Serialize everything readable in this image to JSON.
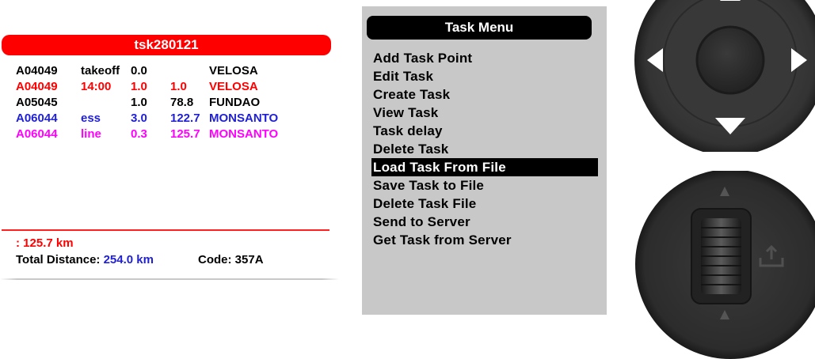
{
  "task": {
    "name": "tsk280121",
    "rows": [
      {
        "code": "A04049",
        "type": "takeoff",
        "radius": "0.0",
        "dist": "",
        "name": "VELOSA",
        "color": "#000000"
      },
      {
        "code": "A04049",
        "type": "14:00",
        "radius": "1.0",
        "dist": "1.0",
        "name": "VELOSA",
        "color": "#ff0000"
      },
      {
        "code": "A05045",
        "type": "",
        "radius": "1.0",
        "dist": "78.8",
        "name": "FUNDAO",
        "color": "#000000"
      },
      {
        "code": "A06044",
        "type": "ess",
        "radius": "3.0",
        "dist": "122.7",
        "name": "MONSANTO",
        "color": "#1f1fd6"
      },
      {
        "code": "A06044",
        "type": "line",
        "radius": "0.3",
        "dist": "125.7",
        "name": "MONSANTO",
        "color": "#ff00ff"
      }
    ],
    "partial_distance": ": 125.7 km",
    "total_label": "Total Distance: ",
    "total_value": "254.0 km",
    "code_label": "Code: 357A"
  },
  "menu": {
    "title": "Task Menu",
    "selected_index": 6,
    "items": [
      "Add Task Point",
      "Edit Task",
      "Create Task",
      "View Task",
      "Task delay",
      "Delete Task",
      "Load Task From File",
      "Save Task to File",
      "Delete Task File",
      "Send to Server",
      "Get Task from Server"
    ]
  },
  "controls": {
    "dpad_icons": [
      "arrow-up-icon",
      "arrow-left-icon",
      "arrow-right-icon",
      "arrow-down-icon"
    ],
    "wheel_icons": [
      "arrow-up-icon",
      "arrow-down-icon",
      "confirm-icon"
    ]
  }
}
